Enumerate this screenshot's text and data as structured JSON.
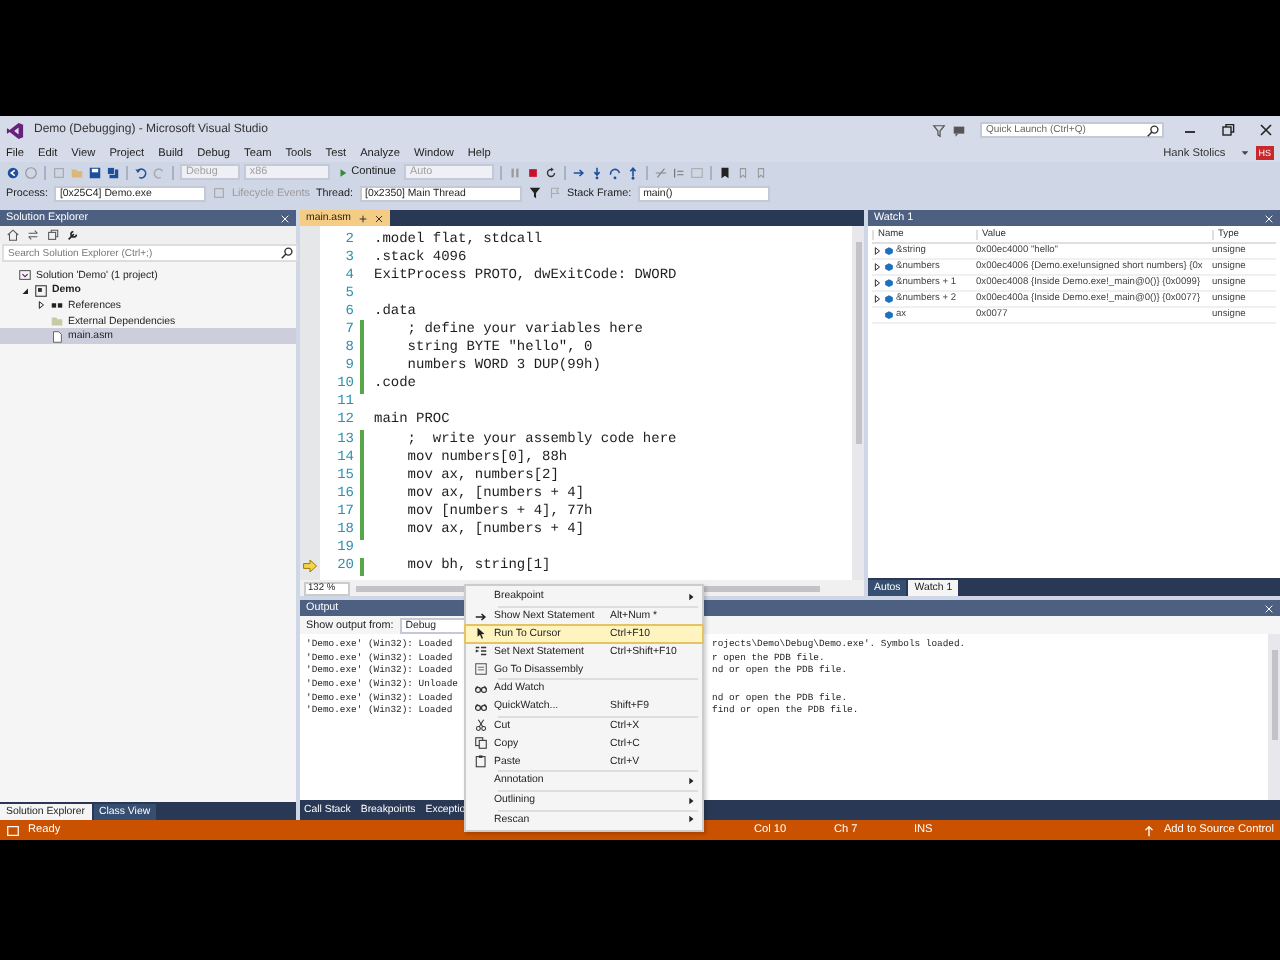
{
  "window": {
    "title": "Demo (Debugging) - Microsoft Visual Studio",
    "quick_launch": {
      "placeholder": "Quick Launch (Ctrl+Q)"
    }
  },
  "menu": [
    "File",
    "Edit",
    "View",
    "Project",
    "Build",
    "Debug",
    "Team",
    "Tools",
    "Test",
    "Analyze",
    "Window",
    "Help"
  ],
  "account": {
    "name": "Hank Stolics",
    "initials": "HS"
  },
  "toolbar": {
    "configuration": "Debug",
    "platform": "x86",
    "continue": "Continue",
    "auto": "Auto"
  },
  "debug_location": {
    "process_label": "Process:",
    "process": "[0x25C4] Demo.exe",
    "lifecycle": "Lifecycle Events",
    "thread_label": "Thread:",
    "thread": "[0x2350] Main Thread",
    "stack_label": "Stack Frame:",
    "stack_frame": "main()"
  },
  "solution_explorer": {
    "title": "Solution Explorer",
    "search": {
      "placeholder": "Search Solution Explorer (Ctrl+;)"
    },
    "tree": [
      {
        "label": "Solution 'Demo' (1 project)",
        "kind": "solution",
        "selected": false,
        "children": [
          {
            "label": "Demo",
            "kind": "project",
            "expanded": true,
            "selected": false,
            "children": [
              {
                "label": "References",
                "kind": "references",
                "expanded": false,
                "selected": false
              },
              {
                "label": "External Dependencies",
                "kind": "folder",
                "selected": false
              },
              {
                "label": "main.asm",
                "kind": "file",
                "selected": true
              }
            ]
          }
        ]
      }
    ],
    "tabs": [
      {
        "label": "Solution Explorer",
        "selected": true
      },
      {
        "label": "Class View",
        "selected": false
      }
    ]
  },
  "editor": {
    "tab": "main.asm",
    "zoom": "132 %",
    "lines": [
      {
        "number": "2",
        "code": ".model flat, stdcall",
        "modified": false,
        "current": false
      },
      {
        "number": "3",
        "code": ".stack 4096",
        "modified": false,
        "current": false
      },
      {
        "number": "4",
        "code": "ExitProcess PROTO, dwExitCode: DWORD",
        "modified": false,
        "current": false
      },
      {
        "number": "5",
        "modified": false,
        "current": false
      },
      {
        "number": "6",
        "code": ".data",
        "modified": false,
        "current": false
      },
      {
        "number": "7",
        "code": "    ; define your variables here",
        "modified": true,
        "current": false
      },
      {
        "number": "8",
        "code": "    string BYTE \"hello\", 0",
        "modified": true,
        "current": false
      },
      {
        "number": "9",
        "code": "    numbers WORD 3 DUP(99h)",
        "modified": true,
        "current": false
      },
      {
        "number": "10",
        "code": ".code",
        "modified": true,
        "current": false
      },
      {
        "number": "11",
        "modified": false,
        "current": false
      },
      {
        "number": "12",
        "code": "main PROC",
        "modified": false,
        "current": false
      },
      {
        "number": "13",
        "code": "    ;  write your assembly code here",
        "modified": true,
        "current": false
      },
      {
        "number": "14",
        "code": "    mov numbers[0], 88h",
        "modified": true,
        "current": false
      },
      {
        "number": "15",
        "code": "    mov ax, numbers[2]",
        "modified": true,
        "current": false
      },
      {
        "number": "16",
        "code": "    mov ax, [numbers + 4]",
        "modified": true,
        "current": false
      },
      {
        "number": "17",
        "code": "    mov [numbers + 4], 77h",
        "modified": true,
        "current": false
      },
      {
        "number": "18",
        "code": "    mov ax, [numbers + 4]",
        "modified": true,
        "current": false
      },
      {
        "number": "19",
        "modified": false,
        "current": false
      },
      {
        "number": "20",
        "code": "    mov bh, string[1]",
        "modified": true,
        "current": true
      }
    ]
  },
  "watch": {
    "title": "Watch 1",
    "columns": [
      "Name",
      "Value",
      "Type"
    ],
    "rows": [
      {
        "name": "&string",
        "value": "0x00ec4000 \"hello\"",
        "type": "unsigne",
        "expandable": true
      },
      {
        "name": "&numbers",
        "value": "0x00ec4006 {Demo.exe!unsigned short numbers} {0x",
        "type": "unsigne",
        "expandable": true
      },
      {
        "name": "&numbers + 1",
        "value": "0x00ec4008 {Inside Demo.exe!_main@0()} {0x0099}",
        "type": "unsigne",
        "expandable": true
      },
      {
        "name": "&numbers + 2",
        "value": "0x00ec400a {Inside Demo.exe!_main@0()} {0x0077}",
        "type": "unsigne",
        "expandable": true
      },
      {
        "name": "ax",
        "value": "0x0077",
        "type": "unsigne",
        "expandable": false
      }
    ],
    "tabs": [
      {
        "label": "Autos",
        "selected": false
      },
      {
        "label": "Watch 1",
        "selected": true
      }
    ]
  },
  "output": {
    "title": "Output",
    "source_label": "Show output from:",
    "source": "Debug",
    "lines": [
      {
        "start": "'Demo.exe' (Win32): Loaded",
        "end": "rojects\\Demo\\Debug\\Demo.exe'. Symbols loaded."
      },
      {
        "start": "'Demo.exe' (Win32): Loaded",
        "end": "r open the PDB file."
      },
      {
        "start": "'Demo.exe' (Win32): Loaded",
        "end": "nd or open the PDB file."
      },
      {
        "start": "'Demo.exe' (Win32): Unloade"
      },
      {
        "start": "'Demo.exe' (Win32): Loaded",
        "end": "nd or open the PDB file."
      },
      {
        "start": "'Demo.exe' (Win32): Loaded",
        "end": "find or open the PDB file."
      }
    ]
  },
  "bottom_tabs": [
    {
      "label": "Call Stack",
      "selected": false
    },
    {
      "label": "Breakpoints",
      "selected": false
    },
    {
      "label": "Exceptio",
      "selected": false
    }
  ],
  "status_bar": {
    "text": "Ready",
    "col": "Col 10",
    "ch": "Ch 7",
    "mode": "INS",
    "source_control": "Add to Source Control"
  },
  "context_menu": [
    {
      "kind": "item",
      "label": "Breakpoint",
      "submenu": true,
      "selected": false
    },
    {
      "kind": "separator"
    },
    {
      "kind": "item",
      "label": "Show Next Statement",
      "shortcut": "Alt+Num *",
      "submenu": false,
      "selected": false
    },
    {
      "kind": "item",
      "label": "Run To Cursor",
      "shortcut": "Ctrl+F10",
      "submenu": false,
      "selected": true
    },
    {
      "kind": "item",
      "label": "Set Next Statement",
      "shortcut": "Ctrl+Shift+F10",
      "submenu": false,
      "selected": false
    },
    {
      "kind": "item",
      "label": "Go To Disassembly",
      "submenu": false,
      "selected": false
    },
    {
      "kind": "separator"
    },
    {
      "kind": "item",
      "label": "Add Watch",
      "submenu": false,
      "selected": false
    },
    {
      "kind": "item",
      "label": "QuickWatch...",
      "shortcut": "Shift+F9",
      "submenu": false,
      "selected": false
    },
    {
      "kind": "separator"
    },
    {
      "kind": "item",
      "label": "Cut",
      "shortcut": "Ctrl+X",
      "submenu": false,
      "selected": false
    },
    {
      "kind": "item",
      "label": "Copy",
      "shortcut": "Ctrl+C",
      "submenu": false,
      "selected": false
    },
    {
      "kind": "item",
      "label": "Paste",
      "shortcut": "Ctrl+V",
      "submenu": false,
      "selected": false
    },
    {
      "kind": "separator"
    },
    {
      "kind": "item",
      "label": "Annotation",
      "submenu": true,
      "selected": false
    },
    {
      "kind": "separator"
    },
    {
      "kind": "item",
      "label": "Outlining",
      "submenu": true,
      "selected": false
    },
    {
      "kind": "separator"
    },
    {
      "kind": "item",
      "label": "Rescan",
      "submenu": true,
      "selected": false
    }
  ]
}
